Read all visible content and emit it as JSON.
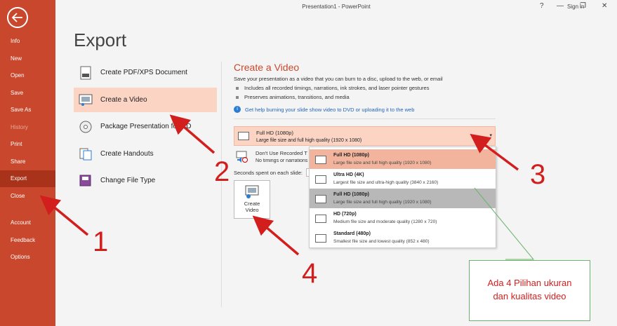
{
  "window": {
    "title": "Presentation1  -  PowerPoint",
    "signin": "Sign in",
    "help": "?",
    "minimize": "—",
    "restore": "❐",
    "close": "✕"
  },
  "sidebar": {
    "items": [
      "Info",
      "New",
      "Open",
      "Save",
      "Save As",
      "History",
      "Print",
      "Share",
      "Export",
      "Close",
      "Account",
      "Feedback",
      "Options"
    ]
  },
  "page_title": "Export",
  "options": [
    "Create PDF/XPS Document",
    "Create a Video",
    "Package Presentation for CD",
    "Create Handouts",
    "Change File Type"
  ],
  "section": {
    "title": "Create a Video",
    "desc": "Save your presentation as a video that you can burn to a disc, upload to the web, or email",
    "bullets": [
      "Includes all recorded timings, narrations, ink strokes, and laser pointer gestures",
      "Preserves animations, transitions, and media"
    ],
    "help_link": "Get help burning your slide show video to DVD or uploading it to the web"
  },
  "quality_select": {
    "name": "Full HD (1080p)",
    "sub": "Large file size and full high quality (1920 x 1080)"
  },
  "timing": {
    "name": "Don't Use Recorded Timings and Narrations",
    "sub": "No timings or narrations have been used"
  },
  "dropdown": [
    {
      "name": "Full HD (1080p)",
      "desc": "Large file size and full high quality (1920 x 1080)"
    },
    {
      "name": "Ultra HD (4K)",
      "desc": "Largest file size and ultra-high quality (3840 x 2160)"
    },
    {
      "name": "Full HD (1080p)",
      "desc": "Large file size and full high quality (1920 x 1080)"
    },
    {
      "name": "HD (720p)",
      "desc": "Medium file size and moderate quality (1280 x 720)"
    },
    {
      "name": "Standard (480p)",
      "desc": "Smallest file size and lowest quality (852 x 480)"
    }
  ],
  "seconds_label": "Seconds spent on each slide:",
  "create_video": {
    "line1": "Create",
    "line2": "Video"
  },
  "annotations": {
    "n1": "1",
    "n2": "2",
    "n3": "3",
    "n4": "4",
    "note_line1": "Ada 4 Pilihan ukuran",
    "note_line2": "dan kualitas video"
  },
  "colors": {
    "accent": "#c9482d",
    "highlight": "#fbd4c4",
    "arrow": "#d31e1e"
  }
}
